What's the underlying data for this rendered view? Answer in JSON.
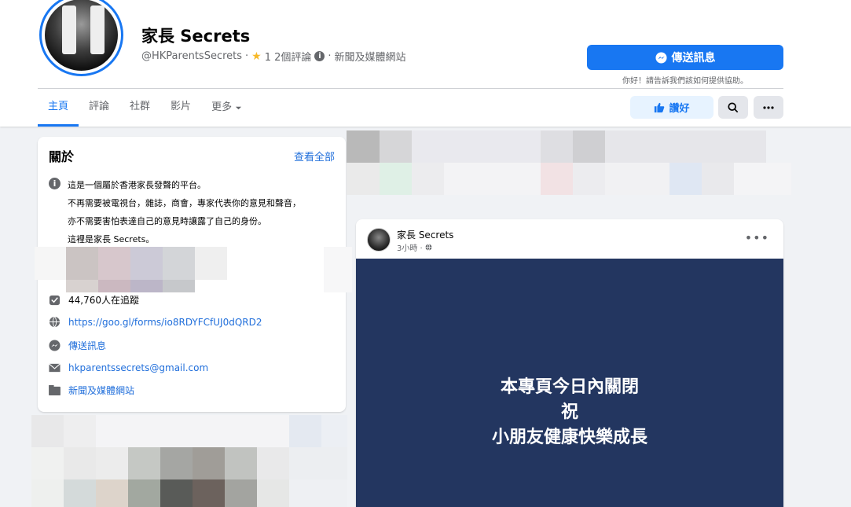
{
  "page": {
    "name": "家長 Secrets",
    "handle": "@HKParentsSecrets",
    "separator": "·",
    "rating_text": "1 2個評論",
    "category": "新聞及媒體網站"
  },
  "actions": {
    "send_message": "傳送訊息",
    "send_hint": "你好！請告訴我們該如何提供協助。",
    "like": "讚好"
  },
  "tabs": [
    {
      "label": "主頁",
      "active": true
    },
    {
      "label": "評論"
    },
    {
      "label": "社群"
    },
    {
      "label": "影片"
    },
    {
      "label": "更多"
    }
  ],
  "about": {
    "title": "關於",
    "see_all": "查看全部",
    "description": [
      "這是一個屬於香港家長發聲的平台。",
      "不再需要被電視台，雜誌，商會，專家代表你的意見和聲音，",
      "亦不需要害怕表達自己的意見時讓露了自己的身份。",
      "這裡是家長 Secrets。"
    ],
    "followers": "44,760人在追蹤",
    "form_link": "https://goo.gl/forms/io8RDYFCfUJ0dQRD2",
    "message_link": "傳送訊息",
    "email": "hkparentssecrets@gmail.com",
    "category": "新聞及媒體網站"
  },
  "post": {
    "author": "家長 Secrets",
    "time": "3小時 ·",
    "image_lines": [
      "本專頁今日內關閉",
      "祝",
      "小朋友健康快樂成長"
    ]
  },
  "colors": {
    "brand_blue": "#1877f2",
    "post_image_bg": "#233660",
    "like_bg": "#e7f3ff"
  }
}
